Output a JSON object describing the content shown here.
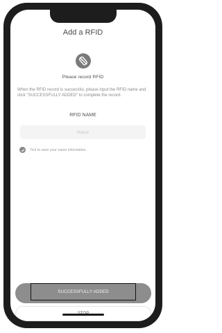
{
  "screen": {
    "title": "Add a RFID",
    "heading": "Please record RFID",
    "description": "When the RFID record is successful, please input the RFID name and click \"SUCCESSFULLY ADDED\" to complete the record.",
    "field_label": "RFID NAME",
    "name_placeholder": "Name",
    "tick_text": "Tick to save your name information.",
    "tick_checked": true,
    "primary_button": "SUCCESSFULLY ADDED",
    "secondary_button": "STOP",
    "hero_icon": "rfid-tag-icon"
  },
  "colors": {
    "frame": "#1d1d1d",
    "primary_button": "#8d8d8d",
    "icon": "#7a7a7a"
  }
}
